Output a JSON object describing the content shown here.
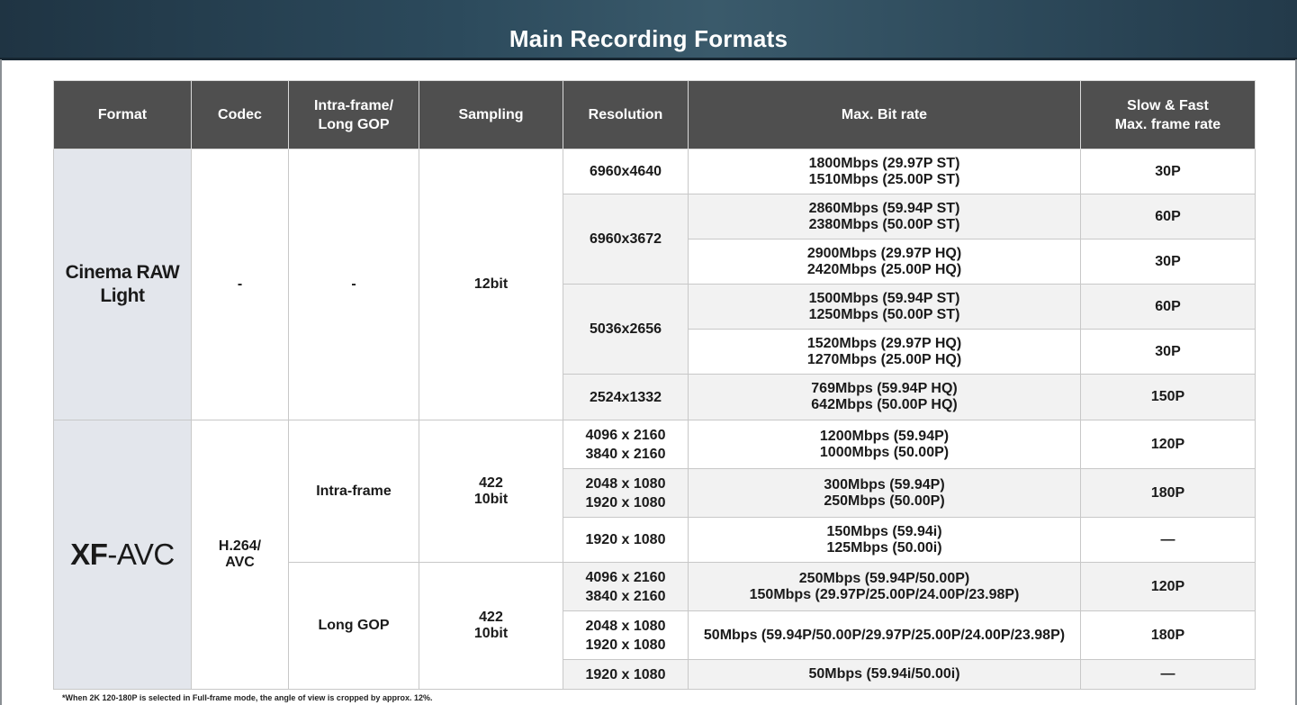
{
  "title": "Main Recording Formats",
  "headers": {
    "format": "Format",
    "codec": "Codec",
    "intra_l1": "Intra-frame/",
    "intra_l2": "Long GOP",
    "sampling": "Sampling",
    "resolution": "Resolution",
    "bitrate": "Max. Bit rate",
    "slow_l1": "Slow & Fast",
    "slow_l2": "Max. frame rate"
  },
  "raw": {
    "format_l1": "Cinema RAW",
    "format_l2": "Light",
    "codec": "-",
    "intra": "-",
    "sampling": "12bit",
    "rows": [
      {
        "res": "6960x4640",
        "r1": "1800Mbps (29.97P ST)",
        "r2": "1510Mbps (25.00P ST)",
        "max": "30P"
      },
      {
        "res": "6960x3672",
        "r1": "2860Mbps (59.94P ST)",
        "r2": "2380Mbps (50.00P ST)",
        "max": "60P"
      },
      {
        "r1": "2900Mbps (29.97P HQ)",
        "r2": "2420Mbps (25.00P HQ)",
        "max": "30P"
      },
      {
        "res": "5036x2656",
        "r1": "1500Mbps (59.94P ST)",
        "r2": "1250Mbps (50.00P ST)",
        "max": "60P"
      },
      {
        "r1": "1520Mbps (29.97P HQ)",
        "r2": "1270Mbps (25.00P HQ)",
        "max": "30P"
      },
      {
        "res": "2524x1332",
        "r1": "769Mbps (59.94P HQ)",
        "r2": "642Mbps (50.00P HQ)",
        "max": "150P"
      }
    ]
  },
  "xf": {
    "logo_bold": "XF",
    "logo_rest": "-AVC",
    "codec_l1": "H.264/",
    "codec_l2": "AVC",
    "intra_label": "Intra-frame",
    "intra_sampling_l1": "422",
    "intra_sampling_l2": "10bit",
    "gop_label": "Long GOP",
    "gop_sampling_l1": "422",
    "gop_sampling_l2": "10bit",
    "rows": [
      {
        "res1": "4096 x 2160",
        "res2": "3840 x 2160",
        "r1": "1200Mbps (59.94P)",
        "r2": "1000Mbps (50.00P)",
        "max": "120P"
      },
      {
        "res1": "2048 x 1080",
        "res2": "1920 x 1080",
        "r1": "300Mbps (59.94P)",
        "r2": "250Mbps (50.00P)",
        "max": "180P"
      },
      {
        "res1": "1920 x 1080",
        "r1": "150Mbps (59.94i)",
        "r2": "125Mbps (50.00i)",
        "max": "—"
      },
      {
        "res1": "4096 x 2160",
        "res2": "3840 x 2160",
        "r1": "250Mbps (59.94P/50.00P)",
        "r2": "150Mbps (29.97P/25.00P/24.00P/23.98P)",
        "max": "120P"
      },
      {
        "res1": "2048 x 1080",
        "res2": "1920 x 1080",
        "r1": "50Mbps (59.94P/50.00P/29.97P/25.00P/24.00P/23.98P)",
        "max": "180P"
      },
      {
        "res1": "1920 x 1080",
        "r1": "50Mbps (59.94i/50.00i)",
        "max": "—"
      }
    ]
  },
  "footnote": "*When 2K 120-180P is selected in Full-frame mode, the angle of view is cropped by approx. 12%."
}
